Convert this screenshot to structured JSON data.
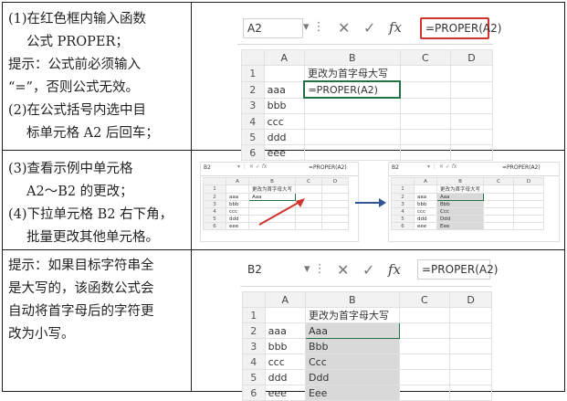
{
  "rows": [
    {
      "lines": [
        "(1)在红色框内输入函数",
        "公式 PROPER；",
        "提示：公式前必须输入",
        "“=”，否则公式无效。",
        "(2)在公式括号内选中目",
        "标单元格 A2 后回车；"
      ],
      "excel": {
        "namebox": "A2",
        "formula": "=PROPER(A2)",
        "fx": "fx",
        "cols": [
          "A",
          "B",
          "C",
          "D"
        ],
        "rows": [
          {
            "n": "1",
            "a": "",
            "b": "更改为首字母大写"
          },
          {
            "n": "2",
            "a": "aaa",
            "b": "=PROPER(A2)"
          },
          {
            "n": "3",
            "a": "bbb",
            "b": ""
          },
          {
            "n": "4",
            "a": "ccc",
            "b": ""
          },
          {
            "n": "5",
            "a": "ddd",
            "b": ""
          },
          {
            "n": "6",
            "a": "eee",
            "b": ""
          }
        ]
      }
    },
    {
      "lines": [
        "(3)查看示例中单元格",
        "A2～B2 的更改；",
        "(4)下拉单元格 B2 右下角，",
        "批量更改其他单元格。"
      ],
      "excel_left": {
        "namebox": "B2",
        "formula": "=PROPER(A2)",
        "rows": [
          {
            "n": "1",
            "a": "",
            "b": "更改为首字母大写"
          },
          {
            "n": "2",
            "a": "aaa",
            "b": "Aaa"
          },
          {
            "n": "3",
            "a": "bbb",
            "b": ""
          },
          {
            "n": "4",
            "a": "ccc",
            "b": ""
          },
          {
            "n": "5",
            "a": "ddd",
            "b": ""
          },
          {
            "n": "6",
            "a": "eee",
            "b": ""
          }
        ]
      },
      "excel_right": {
        "namebox": "B2",
        "formula": "=PROPER(A2)",
        "rows": [
          {
            "n": "1",
            "a": "",
            "b": "更改为首字母大写"
          },
          {
            "n": "2",
            "a": "aaa",
            "b": "Aaa"
          },
          {
            "n": "3",
            "a": "bbb",
            "b": "Bbb"
          },
          {
            "n": "4",
            "a": "ccc",
            "b": "Ccc"
          },
          {
            "n": "5",
            "a": "ddd",
            "b": "Ddd"
          },
          {
            "n": "6",
            "a": "eee",
            "b": "Eee"
          }
        ]
      }
    },
    {
      "lines": [
        "提示：如果目标字符串全",
        "是大写的，该函数公式会",
        "自动将首字母后的字符更",
        "改为小写。"
      ],
      "excel": {
        "namebox": "B2",
        "formula": "=PROPER(A2)",
        "rows": [
          {
            "n": "1",
            "a": "",
            "b": "更改为首字母大写"
          },
          {
            "n": "2",
            "a": "aaa",
            "b": "Aaa"
          },
          {
            "n": "3",
            "a": "bbb",
            "b": "Bbb"
          },
          {
            "n": "4",
            "a": "ccc",
            "b": "Ccc"
          },
          {
            "n": "5",
            "a": "ddd",
            "b": "Ddd"
          },
          {
            "n": "6",
            "a": "eee",
            "b": "Eee"
          }
        ]
      }
    }
  ],
  "colors": {
    "red": "#d0342c",
    "green": "#217346",
    "fill": "#d9d9d9",
    "arrow": "#2f5597"
  }
}
